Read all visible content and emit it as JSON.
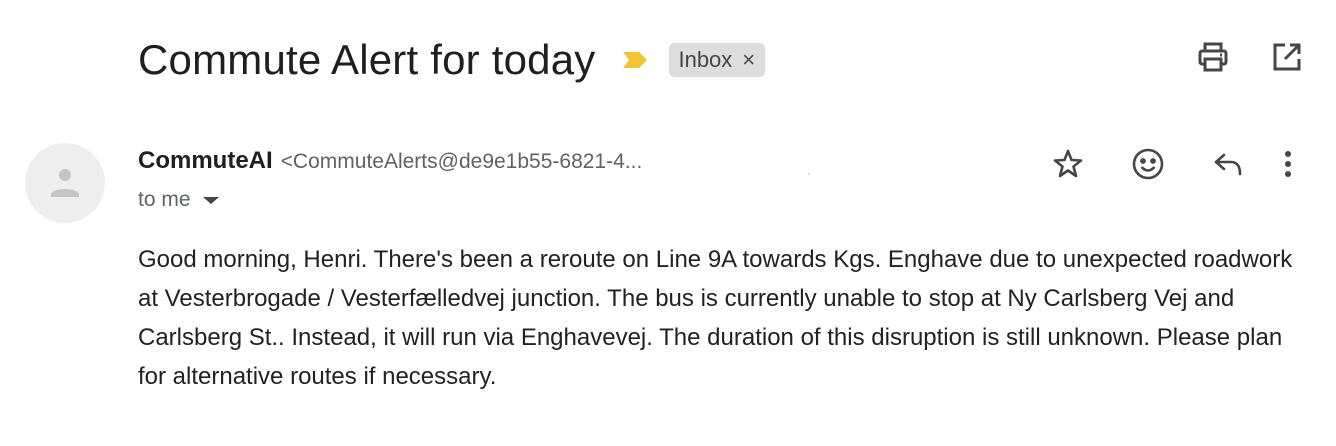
{
  "subject": "Commute Alert for today",
  "label": {
    "name": "Inbox",
    "remove": "×"
  },
  "toolbar": {
    "print_icon": "printer-icon",
    "open_new_window_icon": "open-in-new-icon"
  },
  "sender": {
    "name": "CommuteAI",
    "email": "<CommuteAlerts@de9e1b55-6821-4...",
    "recipient": "to me"
  },
  "message_actions": [
    "star-icon",
    "emoji-icon",
    "reply-icon",
    "more-vert-icon"
  ],
  "body": "Good morning, Henri. There's been a reroute on Line 9A towards Kgs. Enghave due to unexpected roadwork at Vesterbrogade / Vesterfælledvej junction. The bus is currently unable to stop at Ny Carlsberg Vej and Carlsberg St.. Instead, it will run via Enghavevej. The duration of this disruption is still unknown. Please plan for alternative routes if necessary.",
  "colors": {
    "importance_marker": "#f4c430",
    "chip_bg": "#dddddd",
    "avatar_bg": "#eeeeee"
  }
}
